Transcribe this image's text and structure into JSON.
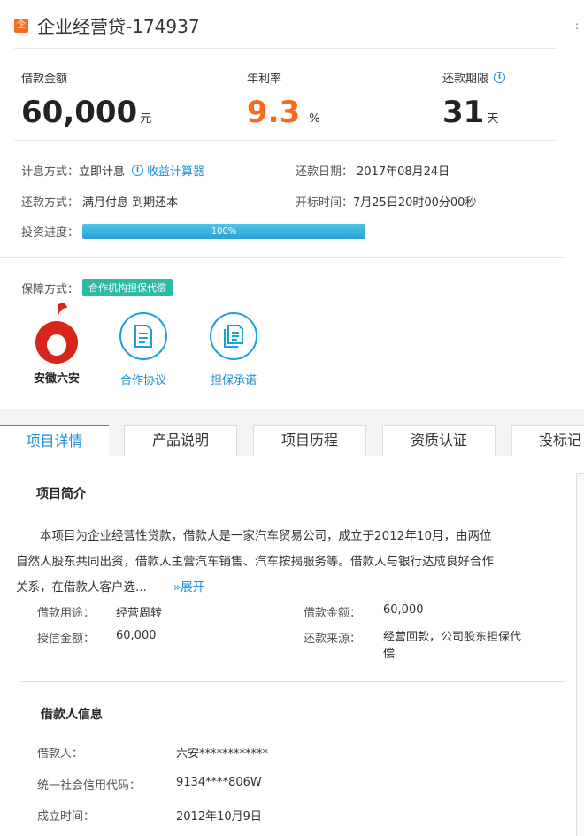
{
  "header": {
    "badge": "企",
    "title": "企业经营贷-174937"
  },
  "stats": {
    "amount_label": "借款金额",
    "amount_value": "60,000",
    "amount_unit": "元",
    "rate_label": "年利率",
    "rate_value": "9.3",
    "rate_unit": "%",
    "term_label": "还款期限",
    "term_value": "31",
    "term_unit": "天"
  },
  "details": {
    "interest_label": "计息方式：",
    "interest_value": "立即计息",
    "calculator_link": "收益计算器",
    "repay_date_label": "还款日期：",
    "repay_date_value": "2017年08月24日",
    "repay_method_label": "还款方式：",
    "repay_method_value": "满月付息 到期还本",
    "open_time_label": "开标时间：",
    "open_time_value": "7月25日20时00分00秒",
    "progress_label": "投资进度：",
    "progress_percent": 100,
    "progress_text": "100%"
  },
  "guarantee": {
    "label": "保障方式：",
    "badge": "合作机构担保代偿",
    "items": [
      {
        "label": "安徽六安",
        "icon": "anhui-liuan-logo"
      },
      {
        "label": "合作协议",
        "icon": "document-icon"
      },
      {
        "label": "担保承诺",
        "icon": "documents-icon"
      }
    ]
  },
  "tabs": [
    "项目详情",
    "产品说明",
    "项目历程",
    "资质认证",
    "投标记"
  ],
  "intro": {
    "title": "项目简介",
    "line1": "本项目为企业经营性贷款，借款人是一家汽车贸易公司，成立于2012年10月，由两位",
    "line2": "自然人股东共同出资，借款人主营汽车销售、汽车按揭服务等。借款人与银行达成良好合作",
    "line3": "关系，在借款人客户选...",
    "expand": "»展开",
    "purpose_label": "借款用途：",
    "purpose_value": "经营周转",
    "loan_amount_label": "借款金额：",
    "loan_amount_value": "60,000",
    "credit_label": "授信金额：",
    "credit_value": "60,000",
    "source_label": "还款来源：",
    "source_value_1": "经营回款，公司股东担保代",
    "source_value_2": "偿"
  },
  "borrower": {
    "title": "借款人信息",
    "name_label": "借款人：",
    "name_value": "六安************",
    "code_label": "统一社会信用代码：",
    "code_value": "9134****806W",
    "founded_label": "成立时间：",
    "founded_value": "2012年10月9日"
  },
  "colors": {
    "accent_blue": "#1a8fd8",
    "orange": "#f56c1f",
    "teal": "#2cb9a5",
    "logo_red": "#d9261c"
  }
}
